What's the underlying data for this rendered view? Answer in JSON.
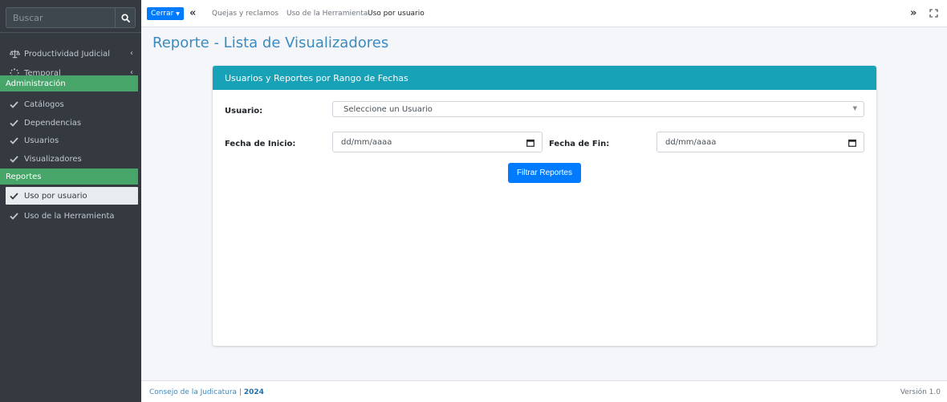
{
  "sidebar": {
    "search_placeholder": "Buscar",
    "items": [
      {
        "label": "Productividad Judicial",
        "icon": "balance-scale-icon"
      },
      {
        "label": "Temporal",
        "icon": "spinner-icon"
      }
    ],
    "admin_header": "Administración",
    "admin_items": [
      {
        "label": "Catálogos"
      },
      {
        "label": "Dependencias"
      },
      {
        "label": "Usuarios"
      },
      {
        "label": "Visualizadores"
      }
    ],
    "reportes_header": "Reportes",
    "reportes_items": [
      {
        "label": "Uso por usuario",
        "active": true
      },
      {
        "label": "Uso de la Herramienta"
      }
    ]
  },
  "topbar": {
    "cerrar_label": "Cerrar",
    "tabs": [
      "Quejas y reclamos",
      "Uso de la Herramienta",
      "Uso por usuario"
    ],
    "active_tab": "Uso por usuario"
  },
  "page": {
    "title": "Reporte - Lista de Visualizadores"
  },
  "card": {
    "header": "Usuarios y Reportes por Rango de Fechas",
    "usuario_label": "Usuario:",
    "usuario_selected": "Seleccione un Usuario",
    "fecha_inicio_label": "Fecha de Inicio:",
    "fecha_inicio_value": "dd/mm/aaaa",
    "fecha_fin_label": "Fecha de Fin:",
    "fecha_fin_value": "dd/mm/aaaa",
    "filter_button": "Filtrar Reportes"
  },
  "footer": {
    "org": "Consejo de la Judicatura | ",
    "year": "2024",
    "version": "Versión 1.0"
  },
  "colors": {
    "sidebar_bg": "#343a40",
    "section_header": "#48a56a",
    "card_header": "#17a2b8",
    "primary": "#007bff",
    "title": "#3a8bc2"
  }
}
